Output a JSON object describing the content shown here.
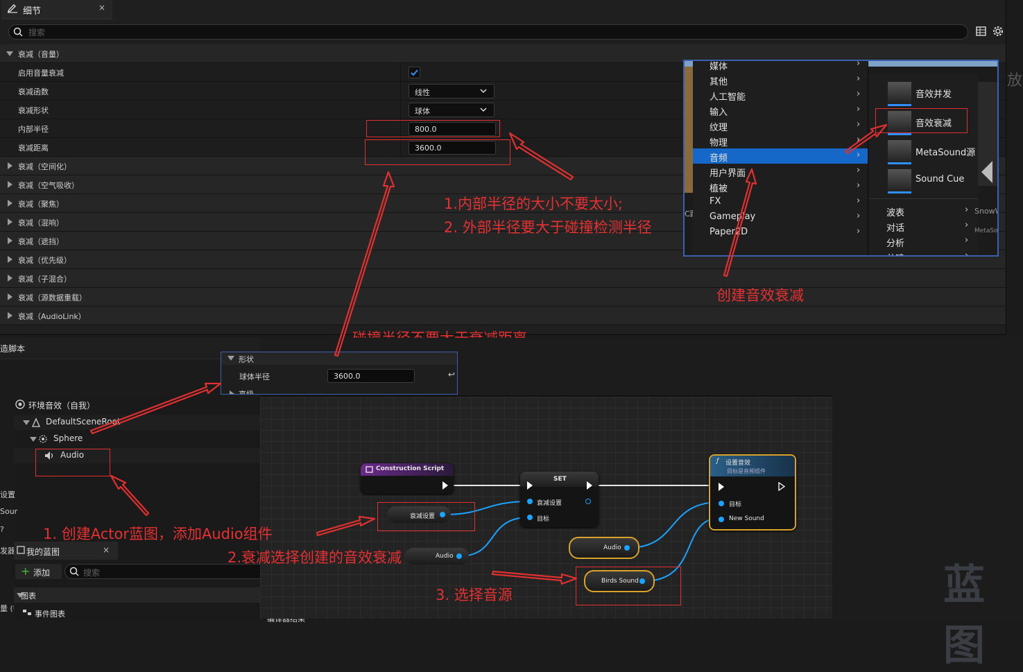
{
  "details": {
    "tab_title": "细节",
    "close": "×",
    "search_placeholder": "搜索",
    "section_volume": "衰减（音量）",
    "props": [
      {
        "label": "启用音量衰减"
      },
      {
        "label": "衰减函数",
        "value": "线性"
      },
      {
        "label": "衰减形状",
        "value": "球体"
      },
      {
        "label": "内部半径",
        "value": "800.0"
      },
      {
        "label": "衰减距离",
        "value": "3600.0"
      }
    ],
    "sections": [
      "衰减（空间化）",
      "衰减（空气吸收）",
      "衰减（聚焦）",
      "衰减（混响）",
      "衰减（遮挡）",
      "衰减（优先级）",
      "衰减（子混合）",
      "衰减（源数据重载）",
      "衰减（AudioLink）"
    ]
  },
  "menu": {
    "left_items": [
      "媒体",
      "其他",
      "人工智能",
      "输入",
      "纹理",
      "物理",
      "音频",
      "用户界面",
      "植被",
      "FX",
      "Gameplay",
      "Paper2D"
    ],
    "selected": "音频",
    "right_items": [
      "音效并发",
      "音效衰减",
      "MetaSound源",
      "Sound Cue"
    ],
    "right_sub": [
      "波表",
      "对话",
      "分析",
      "共鸣"
    ],
    "side_text": [
      "放",
      "SnowW",
      "MetaSo"
    ],
    "left_partial": "C路"
  },
  "annotations": {
    "a1": "1.内部半径的大小不要太小;",
    "a2": "2. 外部半径要大于碰撞检测半径",
    "create": "创建音效衰减",
    "collision": "碰撞半径不要大于衰减距离",
    "step1": "1. 创建Actor蓝图，添加Audio组件",
    "step2": "2.衰减选择创建的音效衰减",
    "step3": "3. 选择音源"
  },
  "shape_panel": {
    "header": "形状",
    "label": "球体半径",
    "value": "3600.0",
    "next": "高级"
  },
  "construction_title": "造脚本",
  "components": {
    "root": "环境音效（自我）",
    "items": [
      "DefaultSceneRoot",
      "Sphere",
      "Audio"
    ]
  },
  "left_fragments": [
    "设置",
    "Sour",
    "?",
    "发器",
    "量 (U"
  ],
  "my_blueprint": {
    "title": "我的蓝图",
    "close": "×",
    "add": "添加",
    "search_placeholder": "搜索",
    "graphs": "图表",
    "event_graph": "事件图表",
    "bottom_partial": "编译器结果"
  },
  "graph": {
    "construction_script": "Construction Script",
    "set_title": "SET",
    "set_pin1": "衰减设置",
    "set_pin2": "目标",
    "atten_var": "衰减设置",
    "audio_var": "Audio",
    "func_title": "设置音效",
    "func_sub": "目标是音频组件",
    "func_pin1": "目标",
    "func_pin2": "New Sound",
    "audio_var2": "Audio",
    "birds": "Birds Sound"
  },
  "watermark": "蓝图"
}
